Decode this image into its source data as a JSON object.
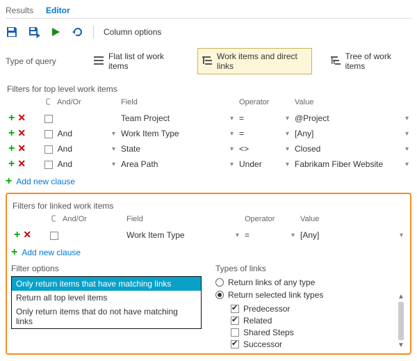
{
  "tabs": {
    "results": "Results",
    "editor": "Editor",
    "active": "editor"
  },
  "toolbar": {
    "column_options": "Column options"
  },
  "query_type": {
    "label": "Type of query",
    "flat": "Flat list of work items",
    "direct": "Work items and direct links",
    "tree": "Tree of work items"
  },
  "top_section": {
    "title": "Filters for top level work items",
    "headers": {
      "andor": "And/Or",
      "field": "Field",
      "op": "Operator",
      "val": "Value"
    },
    "rows": [
      {
        "andor": "",
        "field": "Team Project",
        "op": "=",
        "val": "@Project"
      },
      {
        "andor": "And",
        "field": "Work Item Type",
        "op": "=",
        "val": "[Any]"
      },
      {
        "andor": "And",
        "field": "State",
        "op": "<>",
        "val": "Closed"
      },
      {
        "andor": "And",
        "field": "Area Path",
        "op": "Under",
        "val": "Fabrikam Fiber Website"
      }
    ],
    "add": "Add new clause"
  },
  "linked_section": {
    "title": "Filters for linked work items",
    "headers": {
      "andor": "And/Or",
      "field": "Field",
      "op": "Operator",
      "val": "Value"
    },
    "rows": [
      {
        "andor": "",
        "field": "Work Item Type",
        "op": "=",
        "val": "[Any]"
      }
    ],
    "add": "Add new clause"
  },
  "filter_options": {
    "title": "Filter options",
    "items": [
      "Only return items that have matching links",
      "Return all top level items",
      "Only return items that do not have matching links"
    ],
    "selected_index": 0
  },
  "link_types": {
    "title": "Types of links",
    "any": "Return links of any type",
    "selected": "Return selected link types",
    "choice": "selected",
    "items": [
      {
        "label": "Predecessor",
        "checked": true
      },
      {
        "label": "Related",
        "checked": true
      },
      {
        "label": "Shared Steps",
        "checked": false
      },
      {
        "label": "Successor",
        "checked": true
      }
    ]
  }
}
